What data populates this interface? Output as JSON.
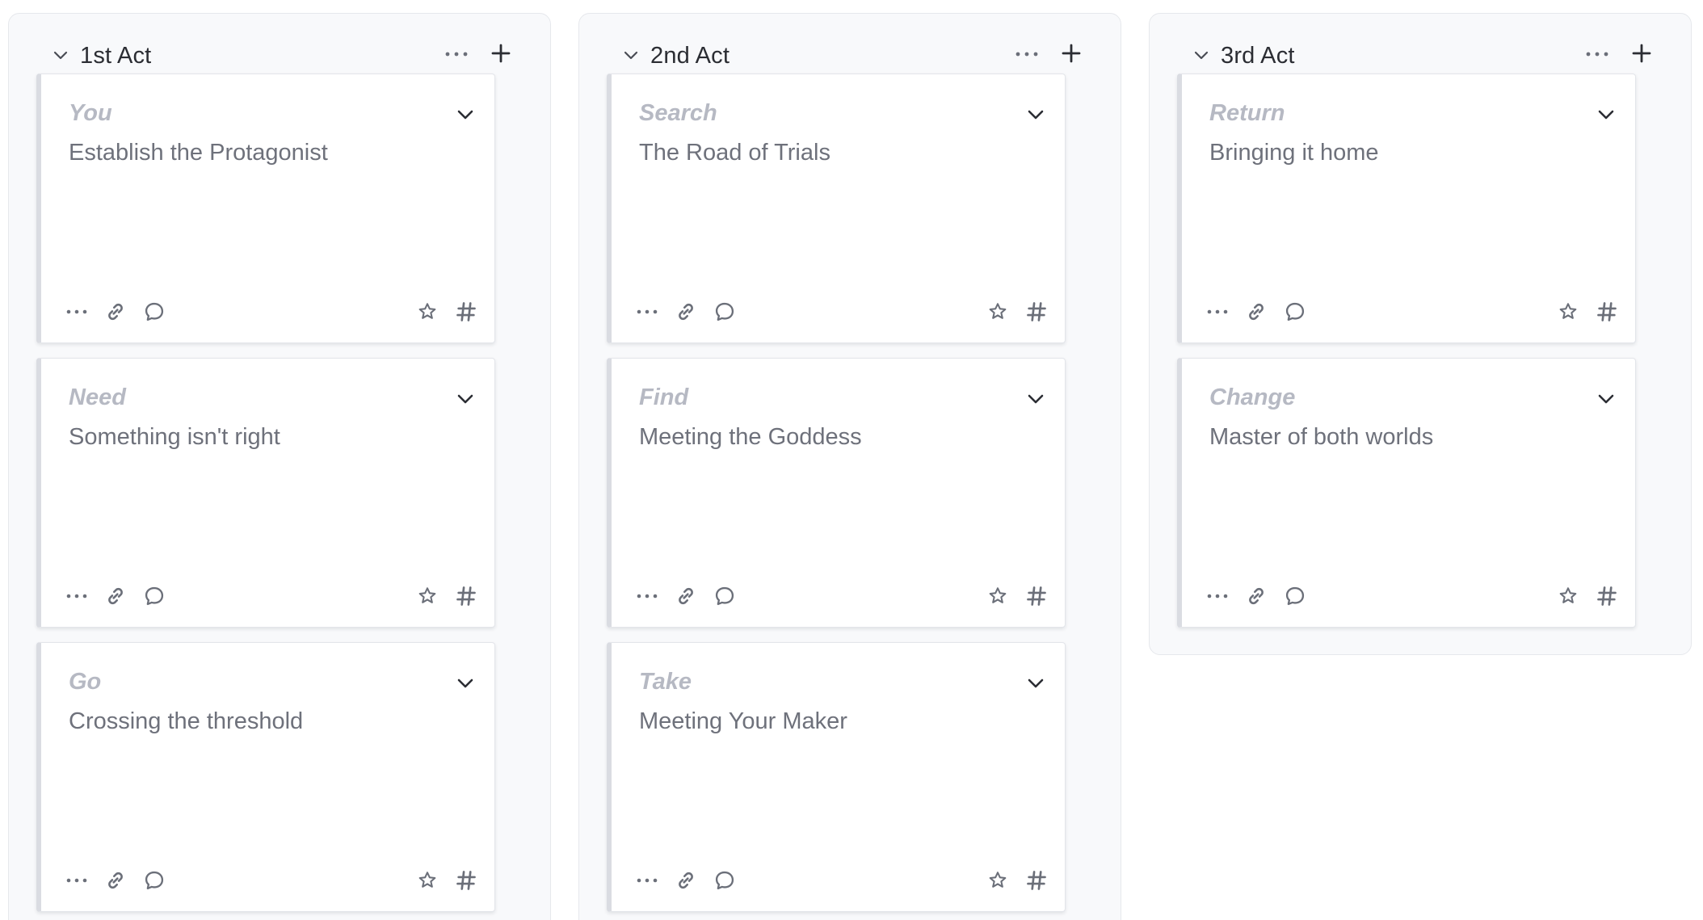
{
  "board": {
    "columns": [
      {
        "title": "1st Act",
        "cards": [
          {
            "label": "You",
            "title": "Establish the Protagonist"
          },
          {
            "label": "Need",
            "title": "Something isn't right"
          },
          {
            "label": "Go",
            "title": "Crossing the threshold"
          }
        ]
      },
      {
        "title": "2nd Act",
        "cards": [
          {
            "label": "Search",
            "title": "The Road of Trials"
          },
          {
            "label": "Find",
            "title": "Meeting the Goddess"
          },
          {
            "label": "Take",
            "title": "Meeting Your Maker"
          }
        ]
      },
      {
        "title": "3rd Act",
        "cards": [
          {
            "label": "Return",
            "title": "Bringing it home"
          },
          {
            "label": "Change",
            "title": "Master of both worlds"
          }
        ]
      }
    ]
  },
  "icons": {
    "collapse": "chevron-down-icon",
    "more": "more-horizontal-icon",
    "add": "plus-icon",
    "card_expand": "chevron-down-icon",
    "link": "link-icon",
    "comment": "comment-icon",
    "star": "star-icon",
    "tag": "hashtag-icon"
  },
  "colors": {
    "column_bg": "#f8f9fb",
    "card_label": "#b6b9c3",
    "card_title": "#6e717b",
    "icon": "#6b6f79",
    "header_text": "#2b2d33"
  }
}
